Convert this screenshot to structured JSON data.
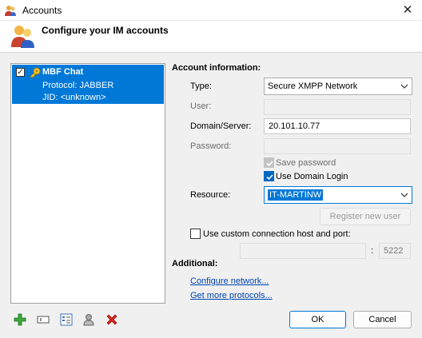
{
  "window": {
    "title": "Accounts",
    "close_glyph": "✕"
  },
  "header": {
    "title": "Configure your IM accounts"
  },
  "accounts": [
    {
      "name": "MBF Chat",
      "protocol": "Protocol: JABBER",
      "jid": "JID: <unknown>",
      "checked": true
    }
  ],
  "account_info": {
    "heading": "Account information:",
    "type_label": "Type:",
    "type_value": "Secure XMPP Network",
    "user_label": "User:",
    "user_value": "",
    "domain_label": "Domain/Server:",
    "domain_value": "20.101.10.77",
    "password_label": "Password:",
    "password_value": "",
    "save_password_label": "Save password",
    "use_domain_login_label": "Use Domain Login",
    "resource_label": "Resource:",
    "resource_value": "IT-MARTINW",
    "register_label": "Register new user",
    "custom_conn_label": "Use custom connection host and port:",
    "host_value": "",
    "port_separator": ":",
    "port_value": "5222"
  },
  "additional": {
    "heading": "Additional:",
    "configure_network": "Configure network...",
    "get_more_protocols": "Get more protocols..."
  },
  "buttons": {
    "ok": "OK",
    "cancel": "Cancel"
  },
  "toolbar": [
    "add-icon",
    "rename-icon",
    "properties-icon",
    "user-icon",
    "delete-icon"
  ],
  "colors": {
    "selection": "#0078d7",
    "add": "#2e9d2e",
    "delete": "#d9241a",
    "link": "#0043b0"
  }
}
